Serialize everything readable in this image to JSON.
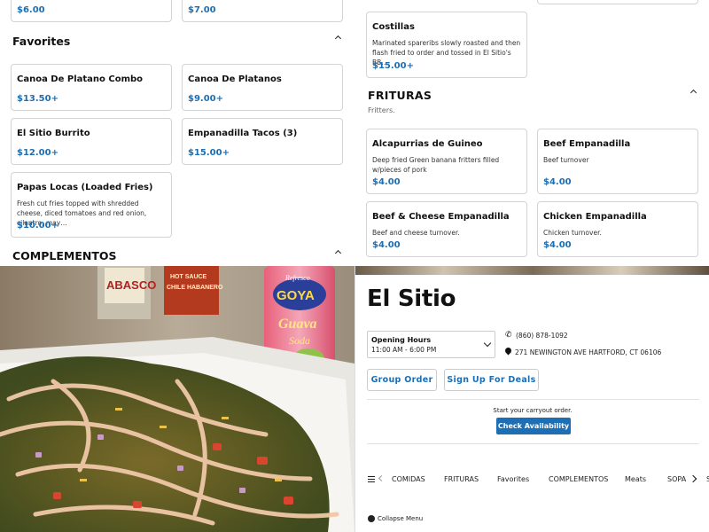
{
  "colors": {
    "accent": "#1c6fb5",
    "text": "#111111",
    "border": "#d3d3d3"
  },
  "menu_left": {
    "partial_prices": [
      "$6.00",
      "$7.00"
    ],
    "favorites": {
      "title": "Favorites",
      "items": [
        {
          "name": "Canoa De Platano Combo",
          "desc": "",
          "price": "$13.50+"
        },
        {
          "name": "Canoa De Platanos",
          "desc": "",
          "price": "$9.00+"
        },
        {
          "name": "El Sitio Burrito",
          "desc": "",
          "price": "$12.00+"
        },
        {
          "name": "Empanadilla Tacos (3)",
          "desc": "",
          "price": "$15.00+"
        },
        {
          "name": "Papas Locas (Loaded Fries)",
          "desc": "Fresh cut fries topped with shredded cheese, diced tomatoes and red onion, cilantro, may…",
          "price": "$10.00+"
        }
      ]
    },
    "complementos_title": "COMPLEMENTOS"
  },
  "menu_right": {
    "costillas": {
      "name": "Costillas",
      "desc": "Marinated spareribs slowly roasted and then flash fried to order and tossed in El Sitio's BB…",
      "price": "$15.00+"
    },
    "frituras": {
      "title": "FRITURAS",
      "subtitle": "Fritters.",
      "items": [
        {
          "name": "Alcapurrias de Guineo",
          "desc": "Deep fried Green banana fritters filled w/pieces of pork",
          "price": "$4.00"
        },
        {
          "name": "Beef Empanadilla",
          "desc": "Beef turnover",
          "price": "$4.00"
        },
        {
          "name": "Beef & Cheese Empanadilla",
          "desc": "Beef and cheese turnover.",
          "price": "$4.00"
        },
        {
          "name": "Chicken Empanadilla",
          "desc": "Chicken turnover.",
          "price": "$4.00"
        }
      ]
    }
  },
  "photo": {
    "icon": "food-photo",
    "bottle_label": "Refresco GOYA Guava Soda",
    "bottle_brand_script": "Refresco",
    "bottle_brand": "GOYA",
    "bottle_flavor": "Guava",
    "bottle_type": "Soda",
    "sauce_left": "ABASCO",
    "sauce_mid_line1": "HOT SAUCE",
    "sauce_mid_line2": "CHILE HABANERO"
  },
  "restaurant": {
    "name": "El Sitio",
    "hours_label": "Opening Hours",
    "hours_value": "11:00 AM - 6:00 PM",
    "phone": "(860) 878-1092",
    "address": "271 NEWINGTON AVE HARTFORD, CT 06106",
    "group_order": "Group Order",
    "sign_up": "Sign Up For Deals",
    "carryout_text": "Start your carryout order.",
    "check_availability": "Check Availability",
    "tabs": [
      "COMIDAS",
      "FRITURAS",
      "Favorites",
      "COMPLEMENTOS",
      "Meats",
      "SOPA",
      "S"
    ],
    "collapse_menu": "Collapse Menu"
  }
}
